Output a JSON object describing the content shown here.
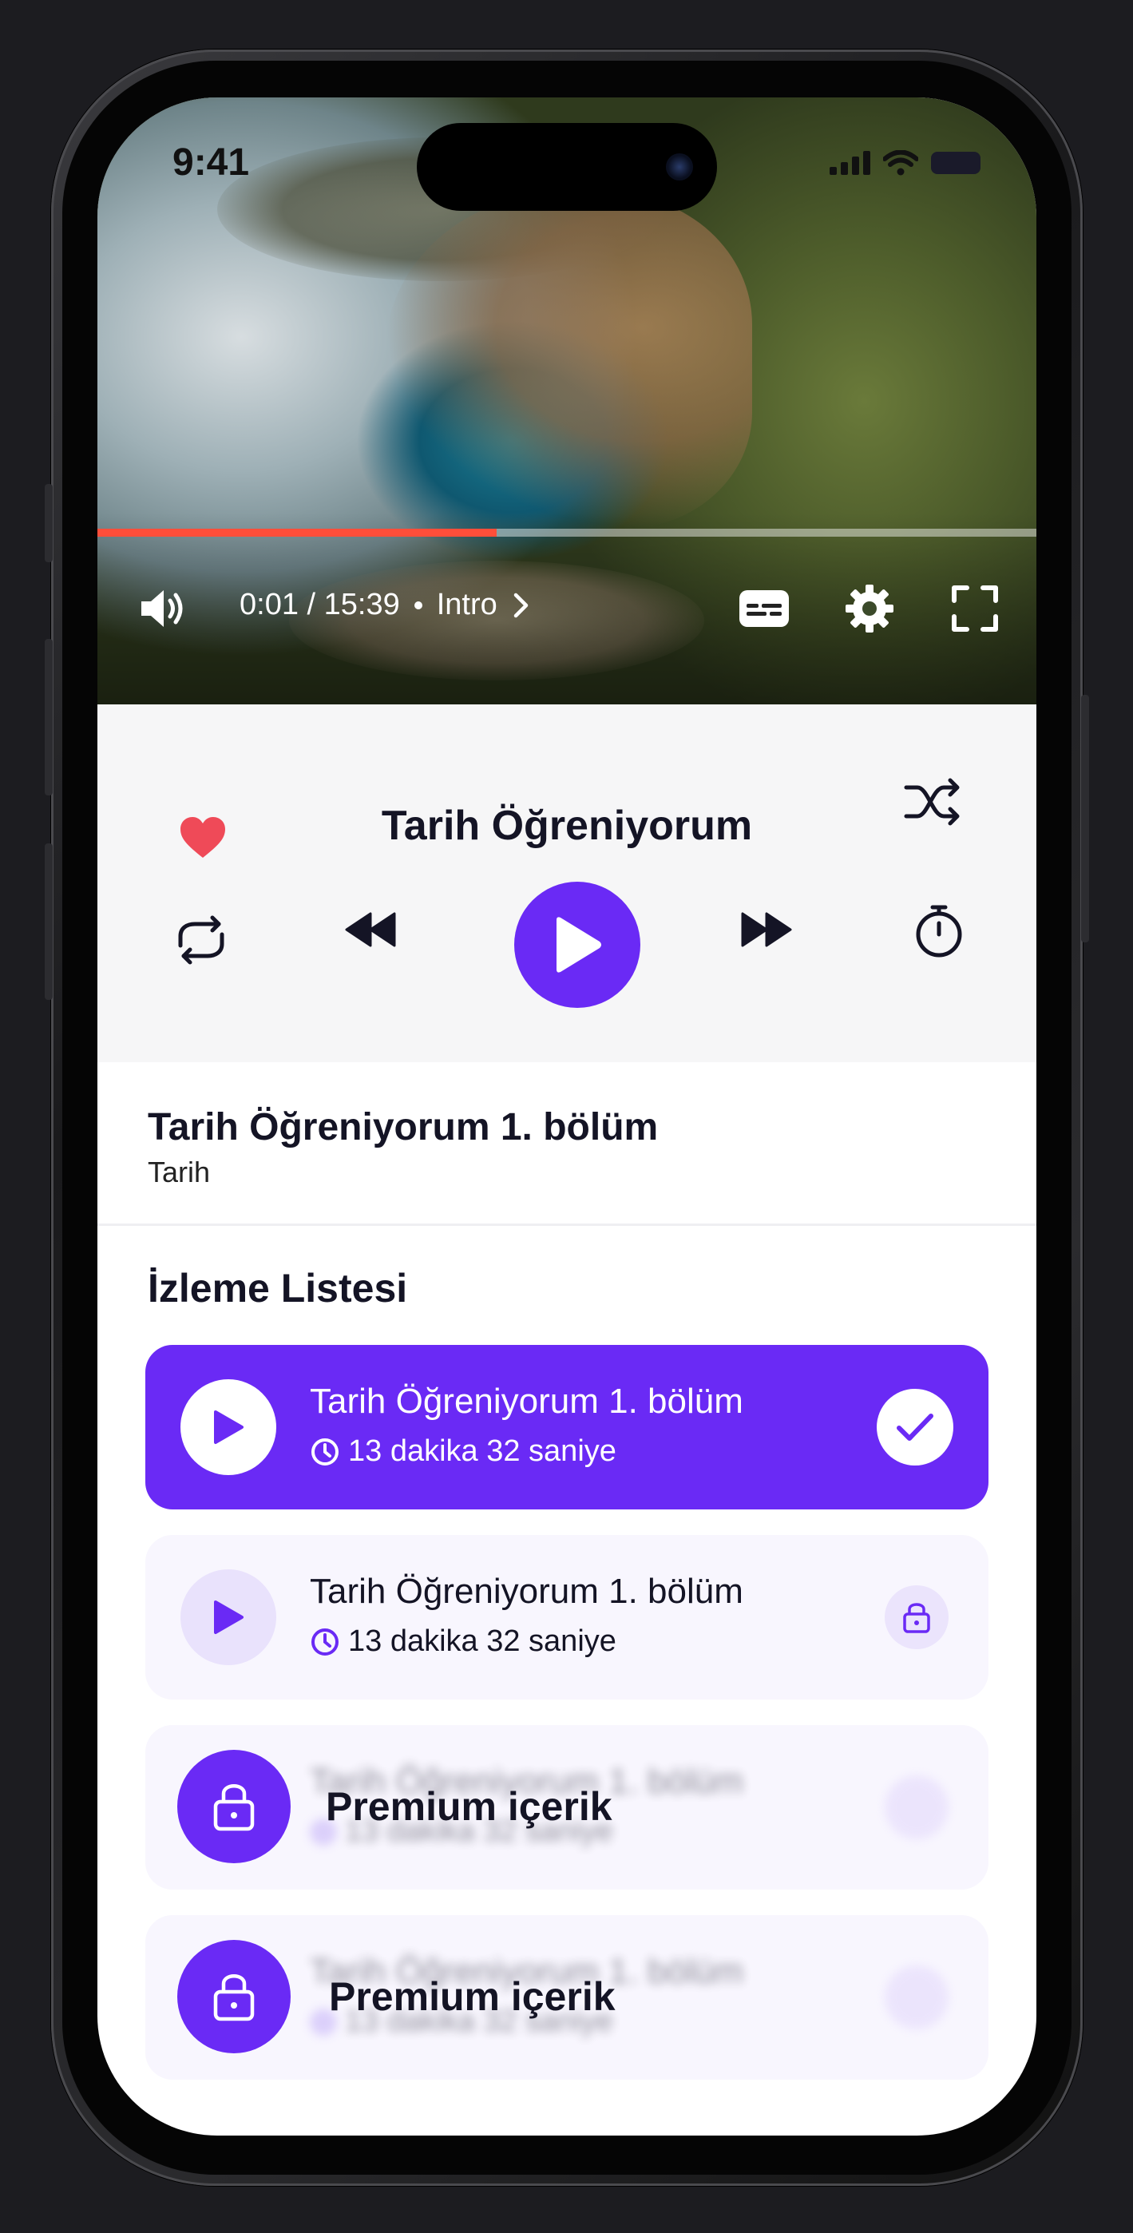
{
  "status_bar": {
    "time": "9:41"
  },
  "video": {
    "time_display": "0:01 / 15:39",
    "chapter": "Intro",
    "progress_fraction": 0.425
  },
  "player": {
    "title": "Tarih Öğreniyorum",
    "favorited": true
  },
  "episode": {
    "title": "Tarih Öğreniyorum 1. bölüm",
    "category": "Tarih"
  },
  "watchlist": {
    "heading": "İzleme Listesi",
    "items": [
      {
        "title": "Tarih Öğreniyorum 1. bölüm",
        "duration": "13 dakika 32 saniye",
        "state": "completed"
      },
      {
        "title": "Tarih Öğreniyorum 1. bölüm",
        "duration": "13 dakika 32 saniye",
        "state": "locked"
      },
      {
        "title": "Tarih Öğreniyorum 1. bölüm",
        "duration": "13 dakika 32 saniye",
        "state": "premium",
        "overlay_label": "Premium içerik"
      },
      {
        "title": "Tarih Öğreniyorum 1. bölüm",
        "duration": "13 dakika 32 saniye",
        "state": "premium",
        "overlay_label": "Premium içerik"
      }
    ]
  },
  "colors": {
    "accent": "#6a2af5",
    "progress": "#ff4e3a",
    "heart": "#ef4a58",
    "text_dark": "#141425"
  }
}
